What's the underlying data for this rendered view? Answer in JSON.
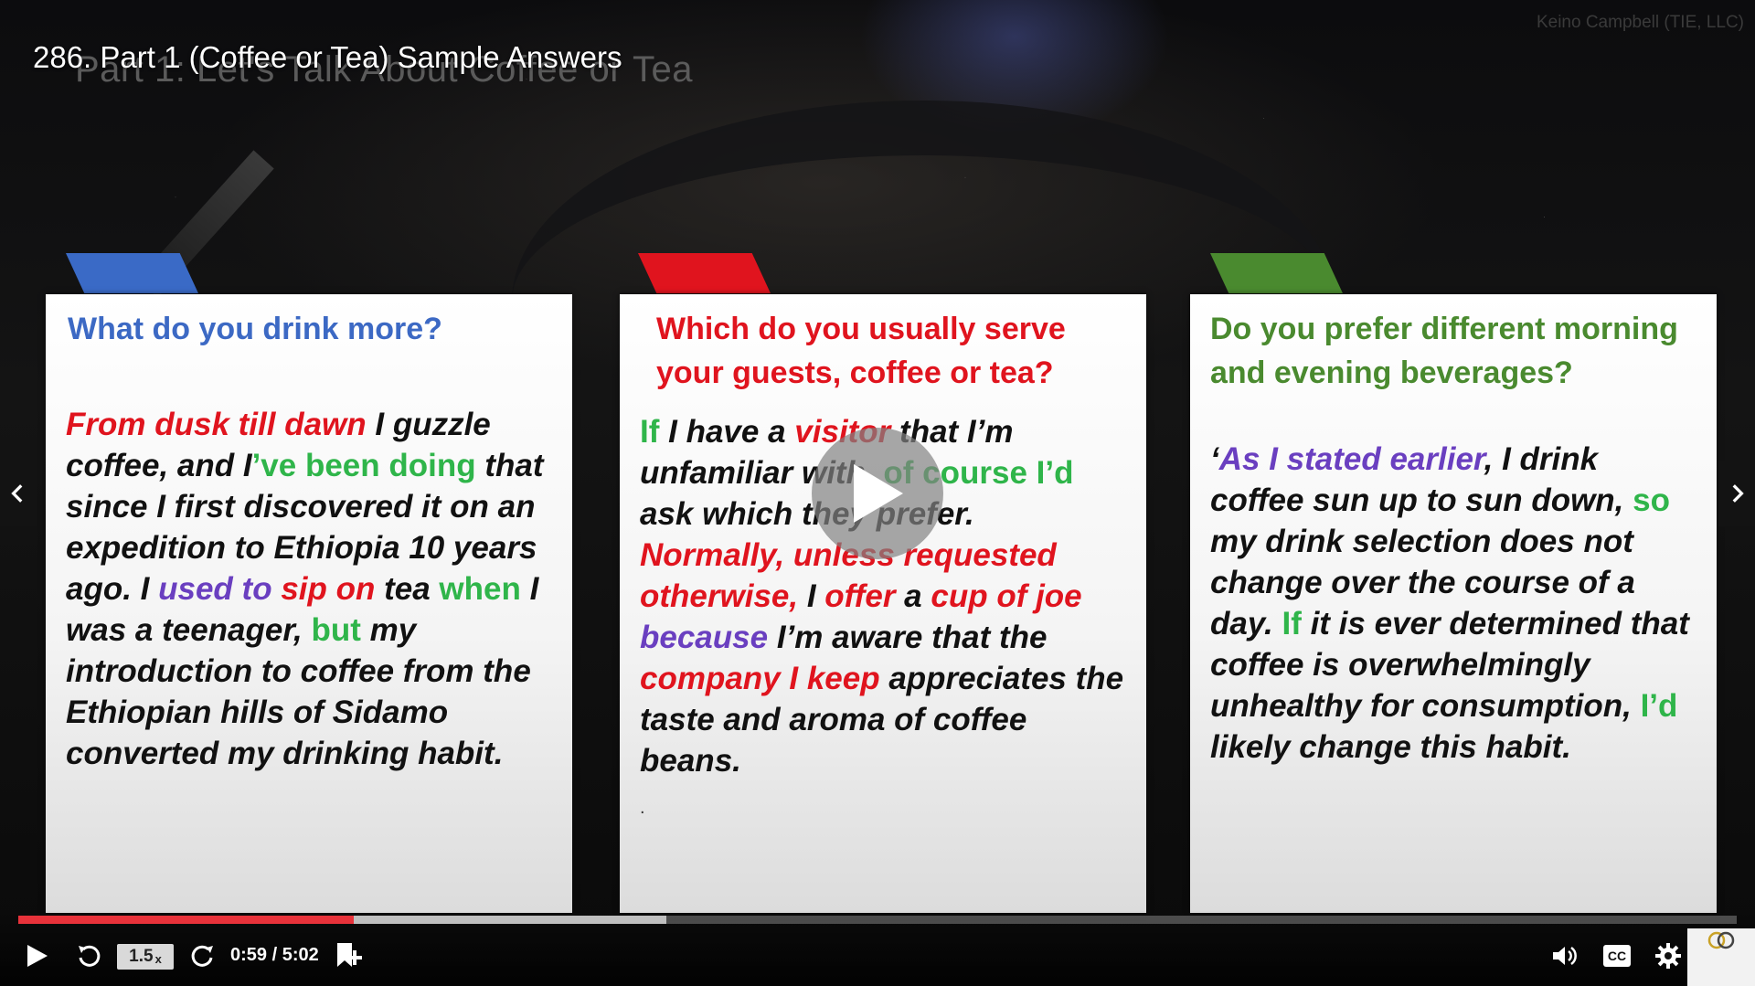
{
  "video": {
    "title": "286. Part 1 (Coffee or Tea) Sample Answers",
    "watermark": "Keino Campbell (TIE, LLC)"
  },
  "slide": {
    "title": "Part 1: Let's Talk About Coffee or Tea",
    "cards": [
      {
        "accent": "#3a6ac6",
        "question": "What do you drink more?",
        "answer": [
          {
            "t": "From dusk till dawn",
            "c": "r"
          },
          {
            "t": " I guzzle coffee, and I",
            "c": ""
          },
          {
            "t": "’ve been doing",
            "c": "g"
          },
          {
            "t": " that since I first discovered it on an expedition to Ethiopia 10 years ago. I ",
            "c": ""
          },
          {
            "t": "used to",
            "c": "p"
          },
          {
            "t": " ",
            "c": ""
          },
          {
            "t": "sip on",
            "c": "r"
          },
          {
            "t": " tea ",
            "c": ""
          },
          {
            "t": "when",
            "c": "g"
          },
          {
            "t": " I was a teenager, ",
            "c": ""
          },
          {
            "t": "but",
            "c": "g"
          },
          {
            "t": " my introduction to coffee from the Ethiopian hills of Sidamo converted my drinking habit.",
            "c": ""
          }
        ]
      },
      {
        "accent": "#e0141e",
        "question": "Which do you usually serve your guests, coffee or tea?",
        "answer": [
          {
            "t": "If",
            "c": "g"
          },
          {
            "t": " I have a ",
            "c": ""
          },
          {
            "t": "visitor",
            "c": "r"
          },
          {
            "t": " that I’m unfamiliar with, ",
            "c": ""
          },
          {
            "t": "of course I’d",
            "c": "g"
          },
          {
            "t": " ask which they prefer. ",
            "c": ""
          },
          {
            "t": "Normally, unless requested otherwise,",
            "c": "r"
          },
          {
            "t": " I ",
            "c": ""
          },
          {
            "t": "offer",
            "c": "r"
          },
          {
            "t": " a ",
            "c": ""
          },
          {
            "t": "cup of joe",
            "c": "r"
          },
          {
            "t": " ",
            "c": ""
          },
          {
            "t": "because",
            "c": "p"
          },
          {
            "t": " I’m aware that the ",
            "c": ""
          },
          {
            "t": "company I keep",
            "c": "r"
          },
          {
            "t": " appreciates the taste and aroma of coffee beans.",
            "c": ""
          }
        ],
        "footnote": "."
      },
      {
        "accent": "#4a8a2f",
        "question": "Do you prefer different morning and evening beverages?",
        "answer": [
          {
            "t": "‘",
            "c": ""
          },
          {
            "t": "As I stated earlier",
            "c": "p"
          },
          {
            "t": ", I drink coffee sun up to sun down, ",
            "c": ""
          },
          {
            "t": "so",
            "c": "g"
          },
          {
            "t": " my drink selection does not change over the course of a day. ",
            "c": ""
          },
          {
            "t": "If",
            "c": "g"
          },
          {
            "t": " it is ever determined that coffee is overwhelmingly unhealthy for consumption, ",
            "c": ""
          },
          {
            "t": "I’d",
            "c": "g"
          },
          {
            "t": " likely change this habit.",
            "c": ""
          }
        ]
      }
    ]
  },
  "player": {
    "rate_value": "1.5",
    "rate_suffix": "x",
    "time_current": "0:59",
    "time_total": "5:02",
    "time_display": "0:59 / 5:02",
    "played_fraction": 0.195,
    "buffered_fraction": 0.377,
    "accent": "#e8323a",
    "icons": [
      "play-icon",
      "rewind-icon",
      "forward-icon",
      "bookmark-add-icon",
      "volume-icon",
      "cc-icon",
      "gear-icon",
      "big-play-icon",
      "chevron-left-icon",
      "chevron-right-icon"
    ]
  }
}
